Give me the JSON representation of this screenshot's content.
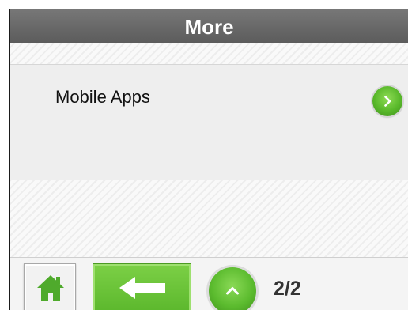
{
  "header": {
    "title": "More"
  },
  "list": {
    "items": [
      {
        "label": "Mobile Apps",
        "icon": "chevron-right-icon"
      }
    ]
  },
  "footer": {
    "home_icon": "home-icon",
    "back_icon": "arrow-left-icon",
    "up_icon": "chevron-up-icon",
    "page_indicator": "2/2"
  },
  "colors": {
    "accent_green": "#5cb82d",
    "titlebar": "#666666"
  }
}
